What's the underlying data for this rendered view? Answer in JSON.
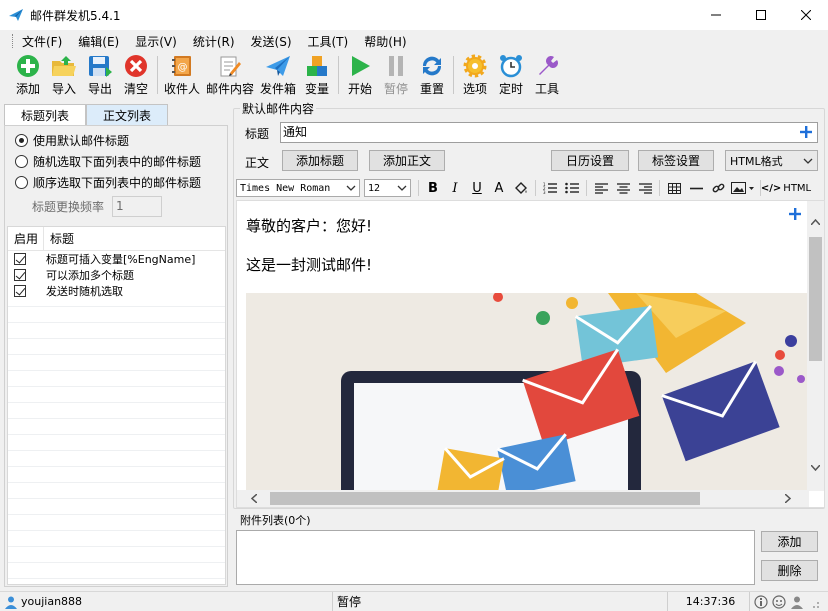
{
  "window": {
    "title": "邮件群发机5.4.1"
  },
  "menu": [
    "文件(F)",
    "编辑(E)",
    "显示(V)",
    "统计(R)",
    "发送(S)",
    "工具(T)",
    "帮助(H)"
  ],
  "toolbar": {
    "add": "添加",
    "import": "导入",
    "export": "导出",
    "clear": "清空",
    "recipients": "收件人",
    "content": "邮件内容",
    "outbox": "发件箱",
    "variables": "变量",
    "start": "开始",
    "pause": "暂停",
    "reset": "重置",
    "options": "选项",
    "timer": "定时",
    "tools": "工具"
  },
  "left": {
    "tab_subject": "标题列表",
    "tab_body": "正文列表",
    "radio_default": "使用默认邮件标题",
    "radio_random": "随机选取下面列表中的邮件标题",
    "radio_sequential": "顺序选取下面列表中的邮件标题",
    "freq_label": "标题更换频率",
    "freq_value": "1",
    "col_enable": "启用",
    "col_subject": "标题",
    "rows": [
      {
        "text": "标题可插入变量[%EngName]"
      },
      {
        "text": "可以添加多个标题"
      },
      {
        "text": "发送时随机选取"
      }
    ]
  },
  "right": {
    "group_title": "默认邮件内容",
    "subject_label": "标题",
    "subject_value": "通知",
    "body_label": "正文",
    "btn_add_subject": "添加标题",
    "btn_add_body": "添加正文",
    "btn_calendar": "日历设置",
    "btn_tags": "标签设置",
    "format_select": "HTML格式",
    "font_select": "Times New Roman",
    "size_select": "12",
    "html_label": "HTML",
    "greeting": "尊敬的客户：您好!",
    "body_line": "这是一封测试邮件!",
    "attach_label": "附件列表(0个)",
    "btn_attach_add": "添加",
    "btn_attach_delete": "删除"
  },
  "status": {
    "user": "youjian888",
    "state": "暂停",
    "time": "14:37:36"
  },
  "colors": {
    "accent": "#1e6fd9",
    "tab_inactive": "#dcecfa"
  }
}
